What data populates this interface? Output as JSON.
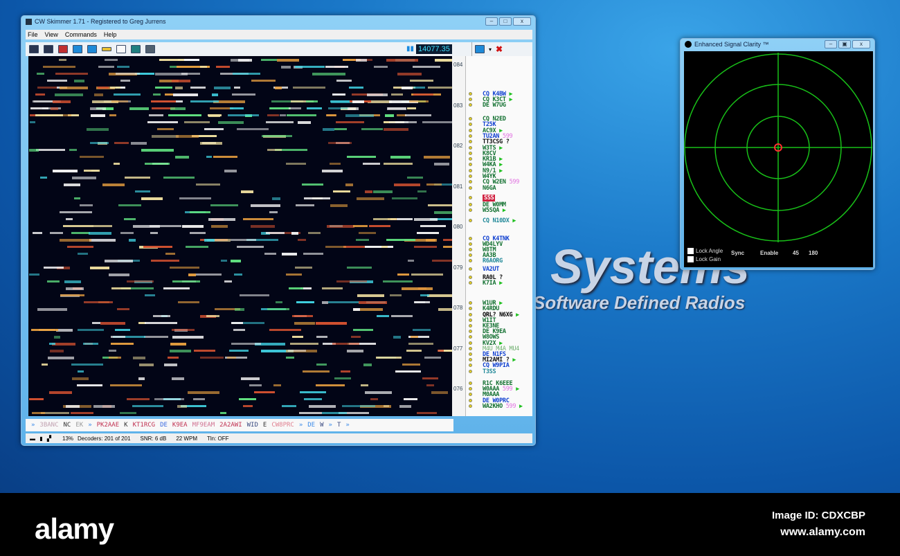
{
  "cw_skimmer": {
    "title": "CW Skimmer 1.71 - Registered to Greg Jurrens",
    "menu": [
      "File",
      "View",
      "Commands",
      "Help"
    ],
    "frequency": "14077.35",
    "scale_labels": [
      "084",
      "083",
      "082",
      "081",
      "080",
      "079",
      "078",
      "077",
      "076"
    ],
    "calls": [
      {
        "text": "CQ K4BW",
        "c": "bl",
        "arrow": true
      },
      {
        "text": "CQ K3CT",
        "c": "g",
        "arrow": true
      },
      {
        "text": "DE W7UG",
        "c": "g"
      },
      {
        "text": "CQ N2ED",
        "c": "g"
      },
      {
        "text": "T25K",
        "c": "bl"
      },
      {
        "text": "AC9X",
        "c": "g",
        "arrow": true
      },
      {
        "text": "TU2AN",
        "c": "bl",
        "rpt": "599"
      },
      {
        "text": "TT3CSG ?",
        "c": "k"
      },
      {
        "text": "W3TS",
        "c": "g",
        "arrow": true
      },
      {
        "text": "K8CV",
        "c": "g"
      },
      {
        "text": "KR1B",
        "c": "g",
        "arrow": true
      },
      {
        "text": "W4KA",
        "c": "g",
        "arrow": true
      },
      {
        "text": "N9/1",
        "c": "g",
        "arrow": true
      },
      {
        "text": "W4YK",
        "c": "g"
      },
      {
        "text": "CQ W2EN",
        "c": "g",
        "rpt": "599"
      },
      {
        "text": "N6GA",
        "c": "g"
      },
      {
        "text": "SSS",
        "c": "sss"
      },
      {
        "text": "DE W0MM",
        "c": "g"
      },
      {
        "text": "W5SQA",
        "c": "g",
        "arrow": true
      },
      {
        "text": "CQ N10DX",
        "c": "t",
        "arrow": true
      },
      {
        "text": "CQ K4TNK",
        "c": "bl"
      },
      {
        "text": "WD4LYV",
        "c": "g"
      },
      {
        "text": "W8TM",
        "c": "g"
      },
      {
        "text": "AA3B",
        "c": "g"
      },
      {
        "text": "R6AORG",
        "c": "t"
      },
      {
        "text": "VA2UT",
        "c": "bl"
      },
      {
        "text": "RA0L ?",
        "c": "k"
      },
      {
        "text": "K7IA",
        "c": "g",
        "arrow": true
      },
      {
        "text": "W1UR",
        "c": "g",
        "arrow": true
      },
      {
        "text": "K4RDU",
        "c": "g"
      },
      {
        "text": "QRL? N6XG",
        "c": "g",
        "arrow": true
      },
      {
        "text": "W1IT",
        "c": "g"
      },
      {
        "text": "KE3NE",
        "c": "g"
      },
      {
        "text": "DE K9EA",
        "c": "g"
      },
      {
        "text": "W8OWS",
        "c": "g"
      },
      {
        "text": "KV2X",
        "c": "g",
        "arrow": true
      },
      {
        "text": "M4U M4A MU4",
        "c": "lg"
      },
      {
        "text": "DE N1FS",
        "c": "bl"
      },
      {
        "text": "MI2AMI ?",
        "c": "k",
        "arrow": true
      },
      {
        "text": "CQ W9PIA",
        "c": "bl"
      },
      {
        "text": "T3SS",
        "c": "t"
      },
      {
        "text": "R1C K6EEE",
        "c": "g"
      },
      {
        "text": "W0AAA",
        "c": "g",
        "rpt": "599",
        "arrow": true
      },
      {
        "text": "M0AAA",
        "c": "g"
      },
      {
        "text": "DE W0PRC",
        "c": "bl"
      },
      {
        "text": "WA2KHO",
        "c": "g",
        "rpt": "599",
        "arrow": true
      }
    ],
    "decoded": [
      {
        "t": "»",
        "c": "#3a8ae8"
      },
      {
        "t": "3BANC",
        "c": "#c0a0b0"
      },
      {
        "t": "NC",
        "c": "#333"
      },
      {
        "t": "EK",
        "c": "#999"
      },
      {
        "t": "»",
        "c": "#3a8ae8"
      },
      {
        "t": "PK2AAE",
        "c": "#c03050"
      },
      {
        "t": "K",
        "c": "#333"
      },
      {
        "t": "KT1RCG",
        "c": "#c03050"
      },
      {
        "t": "DE",
        "c": "#3a6ae0"
      },
      {
        "t": "K9EA",
        "c": "#c03050"
      },
      {
        "t": "MF9EAM",
        "c": "#d07090"
      },
      {
        "t": "2A2AWI",
        "c": "#c03050"
      },
      {
        "t": "WID",
        "c": "#3a4a80"
      },
      {
        "t": "E",
        "c": "#333"
      },
      {
        "t": "CW8PRC",
        "c": "#e08090"
      },
      {
        "t": "»",
        "c": "#3a8ae8"
      },
      {
        "t": "DE",
        "c": "#3a8ae8"
      },
      {
        "t": "W",
        "c": "#3a4a80"
      },
      {
        "t": "»",
        "c": "#3a8ae8"
      },
      {
        "t": "T",
        "c": "#3a4a80"
      },
      {
        "t": "»",
        "c": "#3a8ae8"
      }
    ],
    "status": {
      "cpu": "13%",
      "decoders": "Decoders: 201 of 201",
      "snr": "SNR: 6 dB",
      "wpm": "22 WPM",
      "tln": "Tln: OFF"
    }
  },
  "esc": {
    "title": "Enhanced Signal Clarity ™",
    "lock_angle": "Lock Angle",
    "lock_gain": "Lock Gain",
    "sync": "Sync",
    "enable": "Enable",
    "angle": "45",
    "range": "180"
  },
  "desktop": {
    "brand": "Systems",
    "tagline": "Software Defined Radios"
  },
  "watermark": {
    "logo": "alamy",
    "image_id": "Image ID: CDXCBP",
    "site": "www.alamy.com"
  }
}
